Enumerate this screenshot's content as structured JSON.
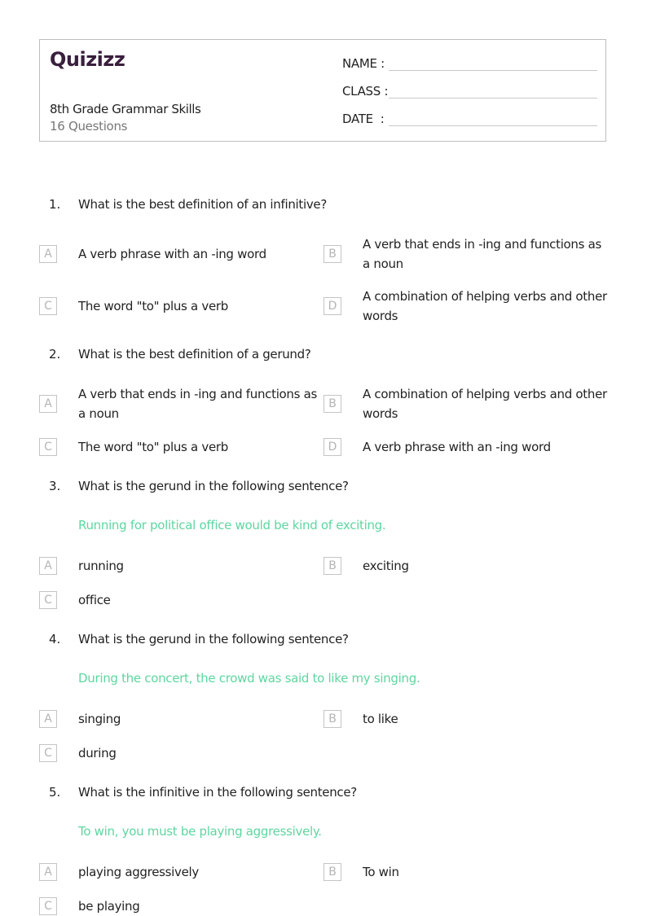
{
  "header": {
    "logo": "Quizizz",
    "title": "8th Grade Grammar Skills",
    "question_count": "16 Questions",
    "fields": [
      {
        "label": "NAME :"
      },
      {
        "label": "CLASS :"
      },
      {
        "label": "DATE  :"
      }
    ]
  },
  "colors": {
    "logo": "#3a1f3d",
    "sentence": "#5ed6a0",
    "border": "#bdbdbd"
  },
  "questions": [
    {
      "number": "1.",
      "text": "What is the best definition of an infinitive?",
      "options": [
        {
          "letter": "A",
          "text": "A verb phrase with an -ing word"
        },
        {
          "letter": "B",
          "text": "A verb that ends in -ing and functions as a noun"
        },
        {
          "letter": "C",
          "text": "The word \"to\" plus a verb"
        },
        {
          "letter": "D",
          "text": "A combination of helping verbs and other words"
        }
      ]
    },
    {
      "number": "2.",
      "text": "What is the best definition of a gerund?",
      "options": [
        {
          "letter": "A",
          "text": "A verb that ends in -ing and functions as a noun"
        },
        {
          "letter": "B",
          "text": "A combination of helping verbs and other words"
        },
        {
          "letter": "C",
          "text": "The word \"to\" plus a verb"
        },
        {
          "letter": "D",
          "text": "A verb phrase with an -ing word"
        }
      ]
    },
    {
      "number": "3.",
      "text": "What is the gerund in the following sentence?",
      "sentence": "Running for political office would be kind of exciting.",
      "options": [
        {
          "letter": "A",
          "text": "running"
        },
        {
          "letter": "B",
          "text": "exciting"
        },
        {
          "letter": "C",
          "text": "office"
        }
      ]
    },
    {
      "number": "4.",
      "text": "What is the gerund in the following sentence?",
      "sentence": "During the concert, the crowd was said to like my singing.",
      "options": [
        {
          "letter": "A",
          "text": "singing"
        },
        {
          "letter": "B",
          "text": "to like"
        },
        {
          "letter": "C",
          "text": "during"
        }
      ]
    },
    {
      "number": "5.",
      "text": "What is the infinitive in the following sentence?",
      "sentence": "To win, you must be playing aggressively.",
      "options": [
        {
          "letter": "A",
          "text": "playing aggressively"
        },
        {
          "letter": "B",
          "text": "To win"
        },
        {
          "letter": "C",
          "text": "be playing"
        }
      ]
    }
  ]
}
